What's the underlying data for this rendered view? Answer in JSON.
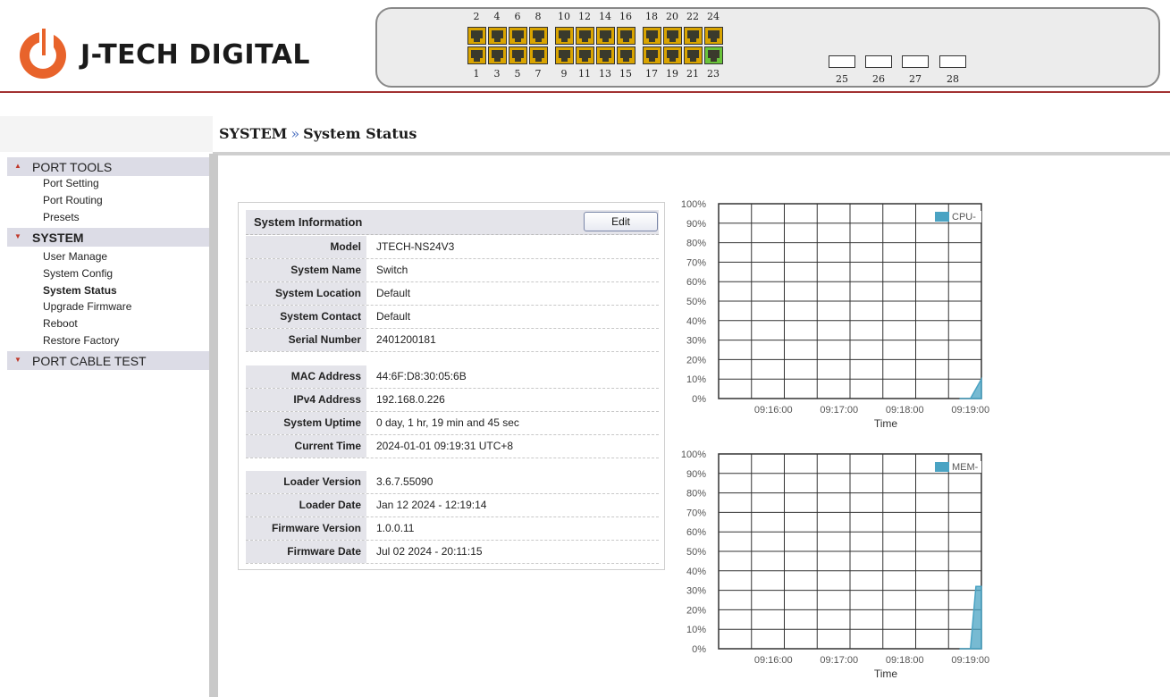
{
  "brand": {
    "name": "J-TECH DIGITAL",
    "accent": "#e8632b"
  },
  "panel": {
    "top_ports": [
      "2",
      "4",
      "6",
      "8",
      "10",
      "12",
      "14",
      "16",
      "18",
      "20",
      "22",
      "24"
    ],
    "bottom_ports": [
      "1",
      "3",
      "5",
      "7",
      "9",
      "11",
      "13",
      "15",
      "17",
      "19",
      "21",
      "23"
    ],
    "active_port": "23",
    "sfp_ports": [
      "25",
      "26",
      "27",
      "28"
    ]
  },
  "breadcrumb": {
    "section": "SYSTEM",
    "separator": "»",
    "page": "System Status"
  },
  "sidebar": {
    "sections": [
      {
        "label": "PORT TOOLS",
        "expanded": true,
        "items": [
          "Port Setting",
          "Port Routing",
          "Presets"
        ]
      },
      {
        "label": "SYSTEM",
        "expanded": true,
        "active": true,
        "items": [
          "User Manage",
          "System Config",
          "System Status",
          "Upgrade Firmware",
          "Reboot",
          "Restore Factory"
        ]
      },
      {
        "label": "PORT CABLE TEST",
        "expanded": false,
        "items": []
      }
    ],
    "active_item": "System Status"
  },
  "info": {
    "title": "System Information",
    "edit_label": "Edit",
    "group1": [
      {
        "key": "Model",
        "value": "JTECH-NS24V3"
      },
      {
        "key": "System Name",
        "value": "Switch"
      },
      {
        "key": "System Location",
        "value": "Default"
      },
      {
        "key": "System Contact",
        "value": "Default"
      },
      {
        "key": "Serial Number",
        "value": "2401200181"
      }
    ],
    "group2": [
      {
        "key": "MAC Address",
        "value": "44:6F:D8:30:05:6B"
      },
      {
        "key": "IPv4 Address",
        "value": "192.168.0.226"
      },
      {
        "key": "System Uptime",
        "value": "0 day, 1 hr, 19 min and 45 sec"
      },
      {
        "key": "Current Time",
        "value": "2024-01-01 09:19:31 UTC+8"
      }
    ],
    "group3": [
      {
        "key": "Loader Version",
        "value": "3.6.7.55090"
      },
      {
        "key": "Loader Date",
        "value": "Jan 12 2024 - 12:19:14"
      },
      {
        "key": "Firmware Version",
        "value": "1.0.0.11"
      },
      {
        "key": "Firmware Date",
        "value": "Jul 02 2024 - 20:11:15"
      }
    ]
  },
  "chart_data": [
    {
      "type": "area",
      "series": [
        {
          "name": "CPU",
          "x": [
            "09:18:50",
            "09:19:00",
            "09:19:10"
          ],
          "values": [
            0,
            0,
            10
          ]
        }
      ],
      "x_ticks": [
        "09:16:00",
        "09:17:00",
        "09:18:00",
        "09:19:00"
      ],
      "y_ticks": [
        "0%",
        "10%",
        "20%",
        "30%",
        "40%",
        "50%",
        "60%",
        "70%",
        "80%",
        "90%",
        "100%"
      ],
      "ylim": [
        0,
        100
      ],
      "xlabel": "Time",
      "ylabel": "",
      "legend": "top-right",
      "grid": true,
      "color": "#4aa3c3"
    },
    {
      "type": "area",
      "series": [
        {
          "name": "MEM",
          "x": [
            "09:18:50",
            "09:19:00",
            "09:19:05",
            "09:19:10"
          ],
          "values": [
            0,
            0,
            32,
            32
          ]
        }
      ],
      "x_ticks": [
        "09:16:00",
        "09:17:00",
        "09:18:00",
        "09:19:00"
      ],
      "y_ticks": [
        "0%",
        "10%",
        "20%",
        "30%",
        "40%",
        "50%",
        "60%",
        "70%",
        "80%",
        "90%",
        "100%"
      ],
      "ylim": [
        0,
        100
      ],
      "xlabel": "Time",
      "ylabel": "",
      "legend": "top-right",
      "grid": true,
      "color": "#4aa3c3"
    }
  ]
}
